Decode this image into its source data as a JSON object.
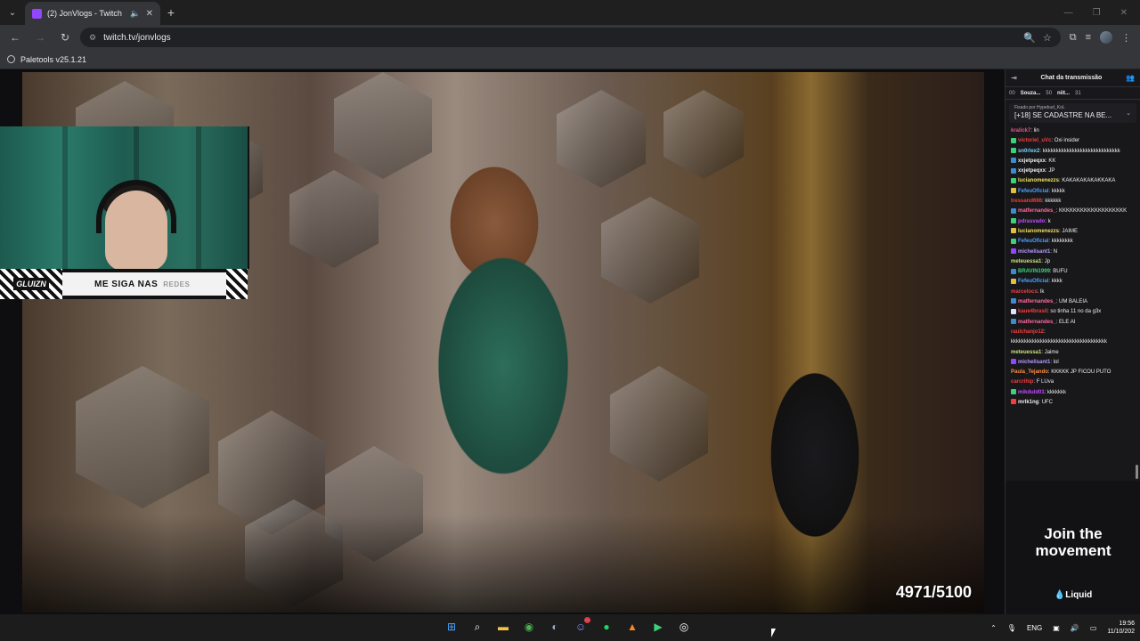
{
  "browser": {
    "tab": {
      "title": "(2) JonVlogs - Twitch"
    },
    "url": "twitch.tv/jonvlogs",
    "extension_label": "Paletools v25.1.21"
  },
  "stream": {
    "counter": "4971/5100",
    "banner_logo": "GLUIZN",
    "banner_text": "ME SIGA NAS",
    "banner_fade": "REDES"
  },
  "chat": {
    "title": "Chat da transmissão",
    "leaderboard": [
      {
        "rank": "00",
        "name": "Souza...",
        "value": "50"
      },
      {
        "rank": "",
        "name": "niit...",
        "value": "31"
      }
    ],
    "pinned_by": "Fixado por Hypebud_KoL",
    "pinned_message": "[+18] SE CADASTRE NA BE...",
    "messages": [
      {
        "user": "kralick7",
        "text": "lin",
        "color": "#e05a8a",
        "badge": ""
      },
      {
        "user": "victoriel_uVc",
        "text": "Oxi insider",
        "color": "#f53d3d",
        "badge": "#3dd17a"
      },
      {
        "user": "sn0rlex2",
        "text": "kkkkkkkkkkkkkkkkkkkkkkkkkkkkk",
        "color": "#7fd1ff",
        "badge": "#3dd17a"
      },
      {
        "user": "xxjetpeqxx",
        "text": "KK",
        "color": "#efeff1",
        "badge": "#3d8bd1"
      },
      {
        "user": "xxjetpeqxx",
        "text": "JP",
        "color": "#efeff1",
        "badge": "#3d8bd1"
      },
      {
        "user": "lucianomenezzs",
        "text": "KAKAKAKAKAKKAKA",
        "color": "#f0e05a",
        "badge": "#3dd17a"
      },
      {
        "user": "FefeuOficial",
        "text": "kkkkk",
        "color": "#4aa3ff",
        "badge": "#e0c040"
      },
      {
        "user": "tressand666",
        "text": "kkkkkk",
        "color": "#f53d3d",
        "badge": ""
      },
      {
        "user": "matfernandes_",
        "text": "KKKKKKKKKKKKKKKKKKK",
        "color": "#ff6b9d",
        "badge": "#3d8bd1"
      },
      {
        "user": "pdrasvado",
        "text": "k",
        "color": "#c04aff",
        "badge": "#3dd17a"
      },
      {
        "user": "lucianomenezzs",
        "text": "JAIME",
        "color": "#f0e05a",
        "badge": "#e0c040"
      },
      {
        "user": "FefeuOficial",
        "text": "kkkkkkkk",
        "color": "#4aa3ff",
        "badge": "#3dd17a"
      },
      {
        "user": "michelisant1",
        "text": "N",
        "color": "#b59aff",
        "badge": "#9146ff"
      },
      {
        "user": "meteuessa1",
        "text": "Jp",
        "color": "#c9e07a",
        "badge": ""
      },
      {
        "user": "BRAVIN1999",
        "text": "BUFU",
        "color": "#3dd17a",
        "badge": "#3d8bd1"
      },
      {
        "user": "FefeuOficial",
        "text": "kkkk",
        "color": "#4aa3ff",
        "badge": "#e0c040"
      },
      {
        "user": "marcelocs",
        "text": "lk",
        "color": "#f53d3d",
        "badge": ""
      },
      {
        "user": "matfernandes_",
        "text": "UM BALEIA",
        "color": "#ff6b9d",
        "badge": "#3d8bd1"
      },
      {
        "user": "kaue4brasil",
        "text": "so tinha 11 no da g3x",
        "color": "#f53d3d",
        "badge": "#e0e0ff"
      },
      {
        "user": "matfernandes_",
        "text": "ELE AI",
        "color": "#ff6b9d",
        "badge": "#3d8bd1"
      },
      {
        "user": "raulchanjo12",
        "text": "kkkkkkkkkkkkkkkkkkkkkkkkkkkkkkkkkkkk",
        "color": "#f53d3d",
        "badge": ""
      },
      {
        "user": "meteuessa1",
        "text": "Jaime",
        "color": "#c9e07a",
        "badge": ""
      },
      {
        "user": "michelisant1",
        "text": "lol",
        "color": "#b59aff",
        "badge": "#9146ff"
      },
      {
        "user": "Paula_Tejando",
        "text": "KKKKK JP FICOU PUTO",
        "color": "#ff8c3d",
        "badge": ""
      },
      {
        "user": "carcrihip",
        "text": "F LUva",
        "color": "#f53d3d",
        "badge": ""
      },
      {
        "user": "mikduld01",
        "text": "kkkkkkk",
        "color": "#c04aff",
        "badge": "#3dd17a"
      },
      {
        "user": "mrlk1ng",
        "text": "UFC",
        "color": "#efeff1",
        "badge": "#f53d3d"
      }
    ],
    "ad_title": "Join the movement",
    "ad_brand": "Liquid"
  },
  "taskbar": {
    "lang": "ENG",
    "time": "19:56",
    "date": "11/10/202",
    "discord_badge": "99+"
  }
}
